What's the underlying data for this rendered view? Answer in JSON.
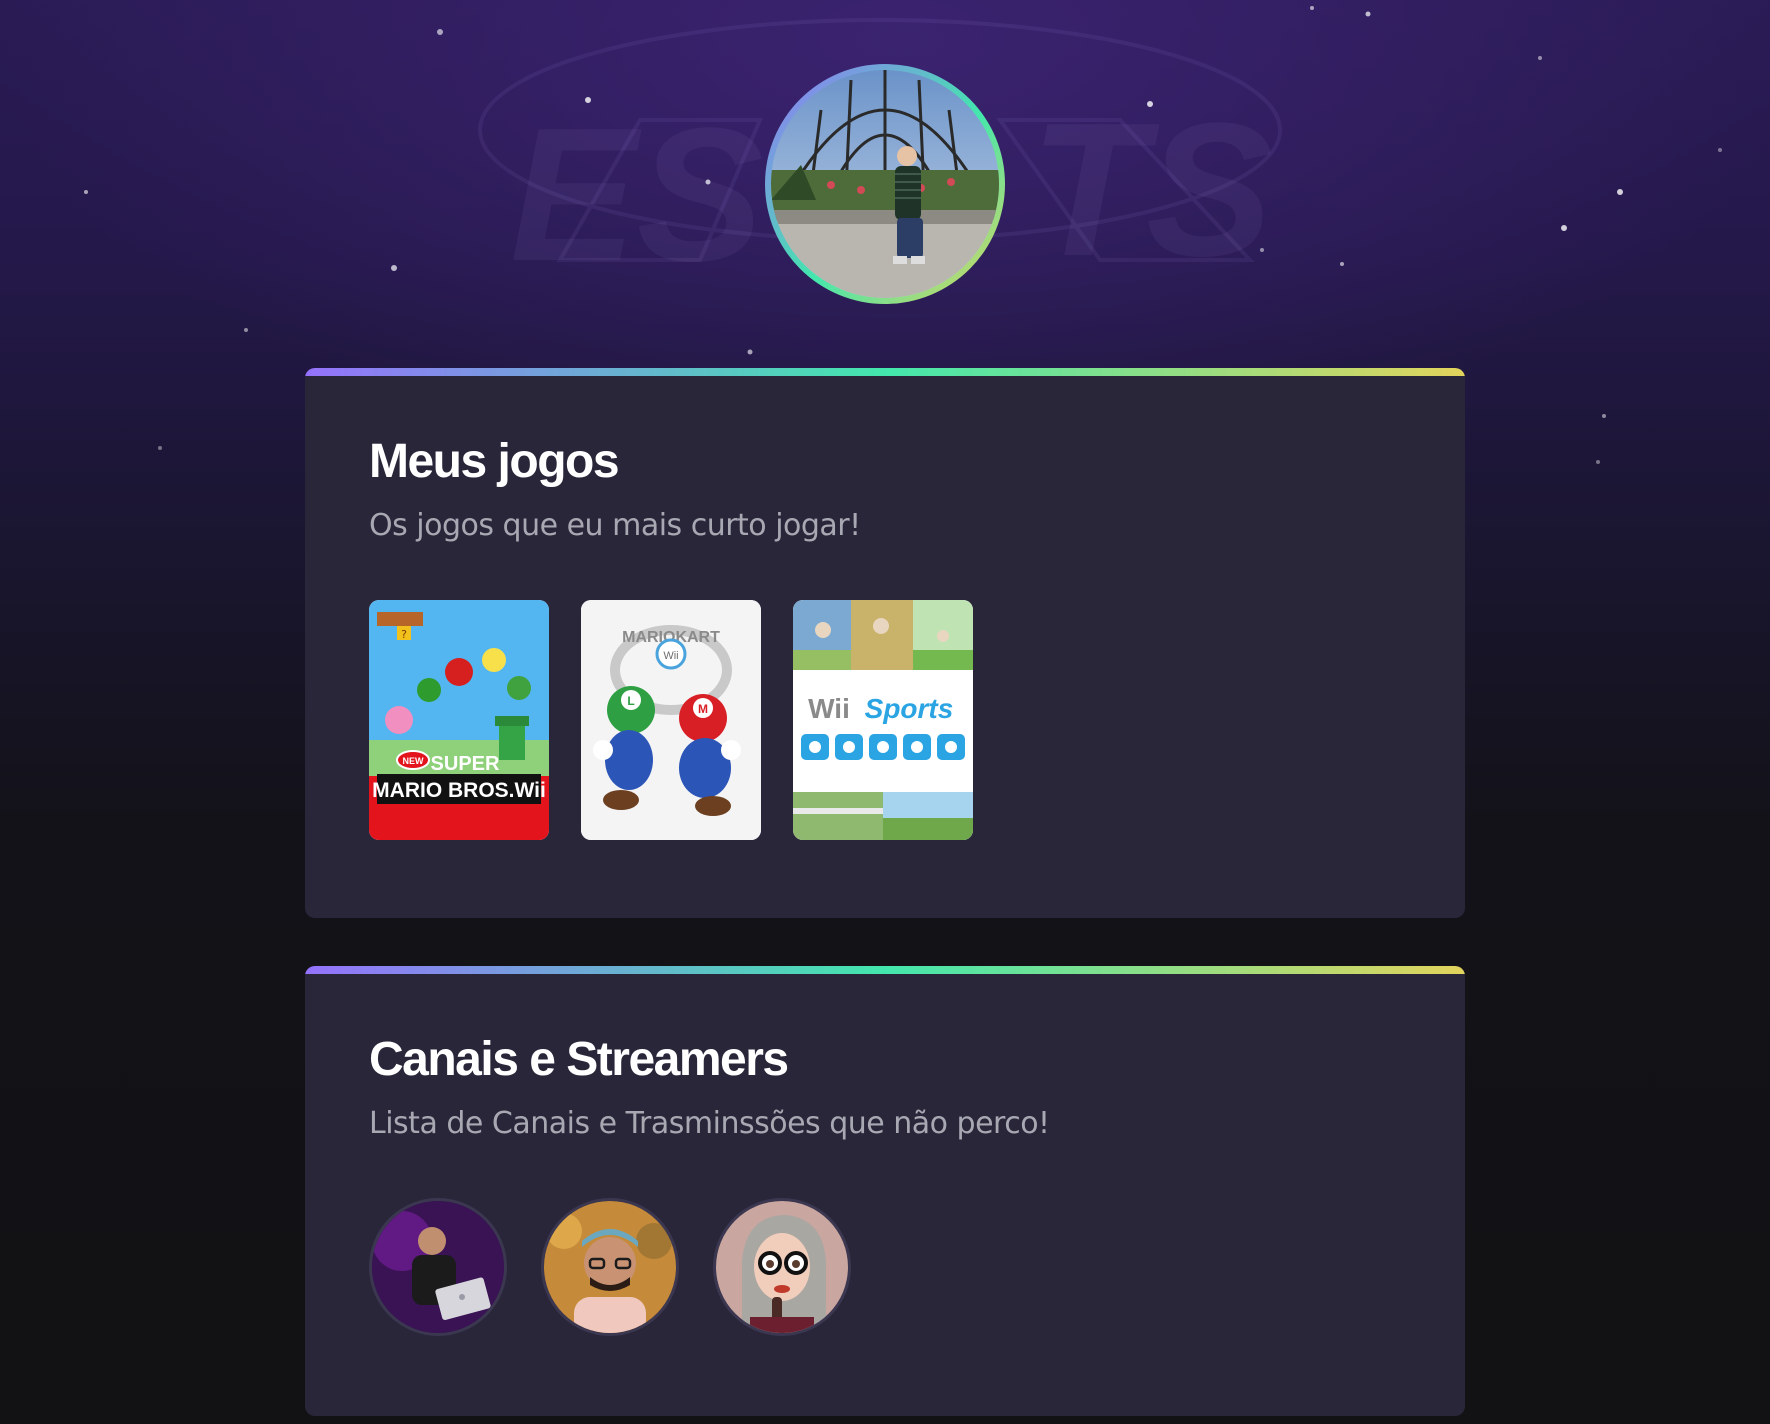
{
  "profile": {
    "avatar_alt": "Foto de perfil"
  },
  "sections": [
    {
      "title": "Meus jogos",
      "subtitle": "Os jogos que eu mais curto jogar!",
      "games": [
        {
          "name": "super-mario-bros-wii",
          "logo_line1": "SUPER",
          "logo_line2": "MARIO BROS.Wii",
          "badge": "NEW"
        },
        {
          "name": "mario-kart-wii",
          "logo_line1": "MARIOKART",
          "logo_line2": "Wii"
        },
        {
          "name": "wii-sports",
          "logo_line1": "Wii",
          "logo_line2": "Sports"
        }
      ]
    },
    {
      "title": "Canais e Streamers",
      "subtitle": "Lista de Canais e Trasminssões que não perco!",
      "channels": [
        {
          "name": "streamer-1"
        },
        {
          "name": "streamer-2"
        },
        {
          "name": "streamer-3"
        }
      ]
    }
  ],
  "colors": {
    "background": "#121214",
    "card": "#29263a",
    "gradient": [
      "#9572fc",
      "#43e7ad",
      "#e2d45c"
    ],
    "subtitle": "#a8a8b3"
  }
}
